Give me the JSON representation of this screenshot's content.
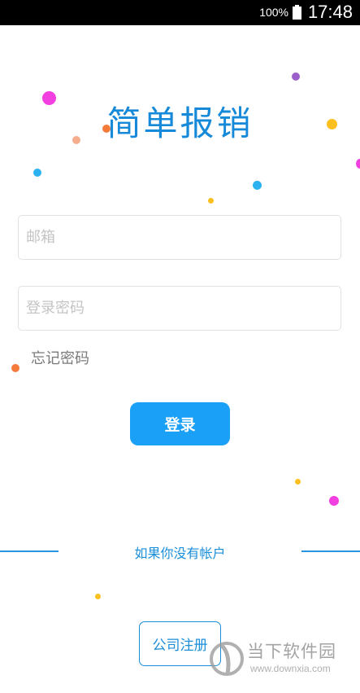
{
  "status_bar": {
    "battery_percent": "100%",
    "battery_icon": "battery-full-icon",
    "time": "17:48"
  },
  "app": {
    "title": "简单报销"
  },
  "login_form": {
    "email_placeholder": "邮箱",
    "email_value": "",
    "password_placeholder": "登录密码",
    "password_value": "",
    "forgot_password_label": "忘记密码",
    "login_button_label": "登录"
  },
  "register": {
    "prompt": "如果你没有帐户",
    "button_label": "公司注册"
  },
  "watermark": {
    "name": "当下软件园",
    "url": "www.downxia.com"
  },
  "colors": {
    "accent": "#1aa0f7",
    "title_blue": "#1689d8",
    "dot_magenta": "#f23fe0",
    "dot_purple": "#9a5fc8",
    "dot_orange": "#f47a3a",
    "dot_peach": "#f5ad8e",
    "dot_yellow": "#fbc020",
    "dot_blue": "#2cb2f0"
  }
}
